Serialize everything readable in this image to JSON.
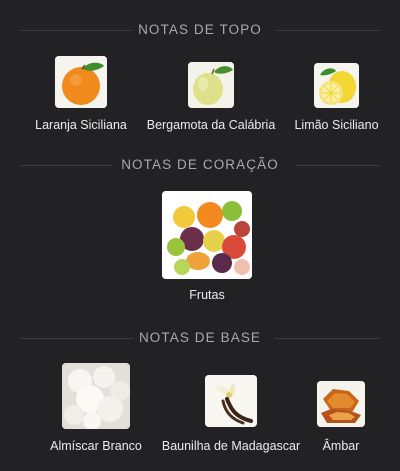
{
  "sections": {
    "top": {
      "title": "NOTAS DE TOPO",
      "items": [
        {
          "label": "Laranja Siciliana",
          "icon": "orange-icon"
        },
        {
          "label": "Bergamota da Calábria",
          "icon": "bergamot-icon"
        },
        {
          "label": "Limão Siciliano",
          "icon": "lemon-icon"
        }
      ]
    },
    "heart": {
      "title": "NOTAS DE CORAÇÃO",
      "items": [
        {
          "label": "Frutas",
          "icon": "fruits-icon"
        }
      ]
    },
    "base": {
      "title": "NOTAS DE BASE",
      "items": [
        {
          "label": "Almíscar Branco",
          "icon": "white-musk-icon"
        },
        {
          "label": "Baunilha de Madagascar",
          "icon": "vanilla-icon"
        },
        {
          "label": "Âmbar",
          "icon": "amber-icon"
        }
      ]
    }
  },
  "colors": {
    "background": "#222224",
    "section_title": "#a9a9ae",
    "label": "#ececef"
  }
}
